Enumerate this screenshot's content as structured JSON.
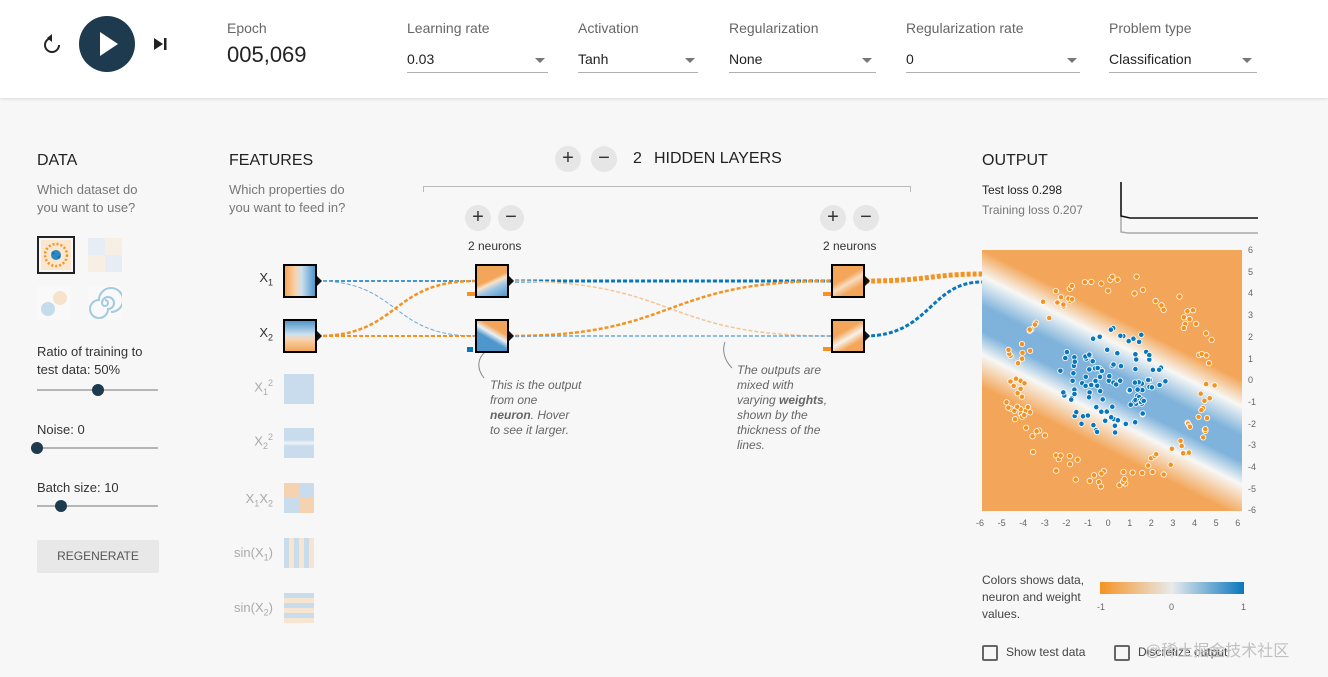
{
  "controls": {
    "epoch": {
      "label": "Epoch",
      "value": "005,069"
    },
    "learning_rate": {
      "label": "Learning rate",
      "value": "0.03"
    },
    "activation": {
      "label": "Activation",
      "value": "Tanh"
    },
    "regularization": {
      "label": "Regularization",
      "value": "None"
    },
    "regularization_rate": {
      "label": "Regularization rate",
      "value": "0"
    },
    "problem_type": {
      "label": "Problem type",
      "value": "Classification"
    }
  },
  "data": {
    "title": "DATA",
    "question": "Which dataset do you want to use?",
    "ratio_label": "Ratio of training to test data:  50%",
    "ratio_value": 0.5,
    "noise_label": "Noise:  0",
    "noise_value": 0,
    "batch_label": "Batch size:  10",
    "batch_value": 0.2,
    "regenerate": "REGENERATE"
  },
  "features": {
    "title": "FEATURES",
    "question": "Which properties do you want to feed in?",
    "items": [
      "X1",
      "X2",
      "X1^2",
      "X2^2",
      "X1X2",
      "sin(X1)",
      "sin(X2)"
    ]
  },
  "network": {
    "count": "2",
    "hidden_label": "HIDDEN LAYERS",
    "layer1_neurons": "2 neurons",
    "layer2_neurons": "2 neurons",
    "note1": {
      "l1": "This is the output",
      "l2": "from one",
      "l3b": "neuron",
      "l3": ". Hover",
      "l4": "to see it larger."
    },
    "note2": {
      "l1": "The outputs are",
      "l2": "mixed with",
      "l3a": "varying ",
      "l3b": "weights",
      "l3c": ",",
      "l4": "shown by the",
      "l5": "thickness of the",
      "l6": "lines."
    }
  },
  "output": {
    "title": "OUTPUT",
    "test_loss": "Test loss 0.298",
    "training_loss": "Training loss 0.207",
    "y_ticks": [
      "6",
      "5",
      "4",
      "3",
      "2",
      "1",
      "0",
      "-1",
      "-2",
      "-3",
      "-4",
      "-5",
      "-6"
    ],
    "x_ticks": [
      "-6",
      "-5",
      "-4",
      "-3",
      "-2",
      "-1",
      "0",
      "1",
      "2",
      "3",
      "4",
      "5",
      "6"
    ],
    "legend_text": "Colors shows data, neuron and weight values.",
    "legend_ticks": [
      "-1",
      "0",
      "1"
    ],
    "show_test": "Show test data",
    "discretize": "Discretize output"
  },
  "colors": {
    "orange": "#f59322",
    "blue": "#0877bd",
    "dark": "#1d3a4f"
  },
  "icons": [
    "reset-icon",
    "play-icon",
    "step-icon",
    "plus-icon",
    "minus-icon"
  ],
  "watermark": "@稀土掘金技术社区"
}
